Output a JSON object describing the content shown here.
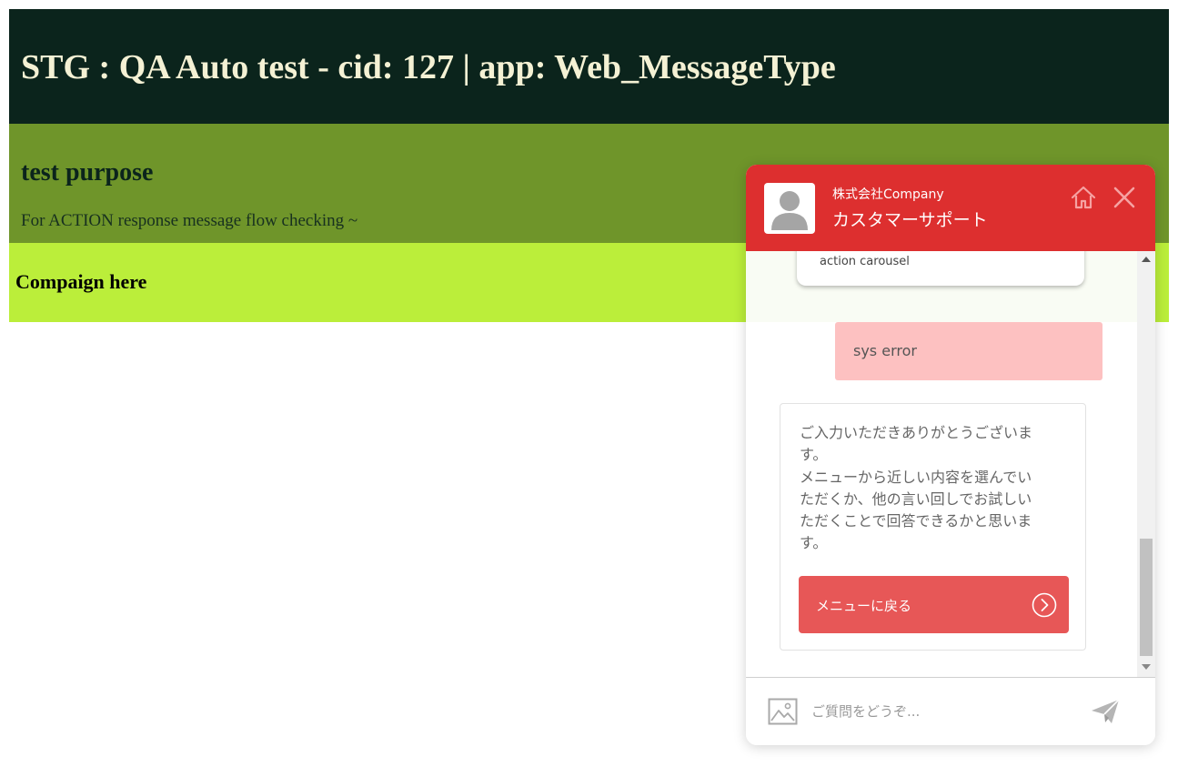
{
  "page": {
    "title": "STG : QA Auto test - cid: 127 | app: Web_MessageType",
    "purpose_heading": "test purpose",
    "purpose_text": "For ACTION response message flow checking ~",
    "campaign_text": "Compaign here"
  },
  "chat": {
    "company": "株式会社Company",
    "team": "カスタマーサポート",
    "home_icon": "home-icon",
    "close_icon": "close-icon",
    "carousel_label": "action carousel",
    "user_message": "sys error",
    "bot_message_lines": [
      "ご入力いただきありがとうございま",
      "す。",
      "メニューから近しい内容を選んでい",
      "ただくか、他の言い回しでお試しい",
      "ただくことで回答できるかと思いま",
      "す。"
    ],
    "menu_button_label": "メニューに戻る",
    "input_placeholder": "ご質問をどうぞ...",
    "image_icon": "image-icon",
    "send_icon": "send-icon"
  },
  "colors": {
    "header_bg": "#0b241c",
    "purpose_bg": "#6f952a",
    "campaign_bg": "#bbee3a",
    "chat_header_bg": "#dd2f2f",
    "user_bubble": "#fdc1c1",
    "menu_button": "#e75757"
  }
}
